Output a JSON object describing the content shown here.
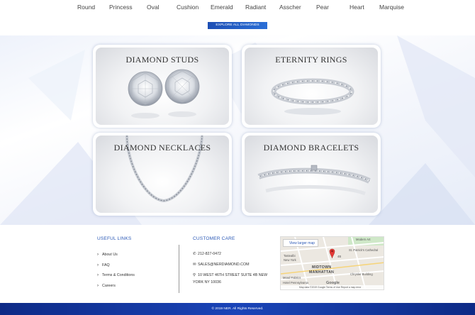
{
  "shapes": [
    "Round",
    "Princess",
    "Oval",
    "Cushion",
    "Emerald",
    "Radiant",
    "Asscher",
    "Pear",
    "Heart",
    "Marquise"
  ],
  "explore_label": "EXPLORE ALL DIAMONDS",
  "cards": [
    {
      "title": "DIAMOND STUDS"
    },
    {
      "title": "ETERNITY RINGS"
    },
    {
      "title": "DIAMOND NECKLACES"
    },
    {
      "title": "DIAMOND BRACELETS"
    }
  ],
  "footer": {
    "useful_links_heading": "USEFUL LINKS",
    "useful_links": [
      "About Us",
      "FAQ",
      "Terms & Conditions",
      "Careers"
    ],
    "customer_care_heading": "CUSTOMER CARE",
    "phone": "212-827-0472",
    "email": "SALES@NERDIAMOND.COM",
    "address_line1": "10 WEST 46TH STREET SUITE 4B NEW",
    "address_line2": "YORK NY 10036"
  },
  "map": {
    "view_larger": "View larger map",
    "labels": {
      "moma": "Modern Art",
      "tastealbi": "Tastealbi",
      "ny": "New York",
      "stpatrick": "St. Patrick's Cathedral",
      "midtown": "MIDTOWN",
      "manhattan": "MANHATTAN",
      "mood": "Mood Fabrics",
      "chrysler": "Chrysler Building",
      "pennsylvania": "Hotel Pennsylvania",
      "pin": "4B"
    },
    "google": "Google",
    "footer_text": "Map data ©2019 Google   Terms of Use   Report a map error"
  },
  "copyright": "© 2019 NER. All Rights Reserved.",
  "colors": {
    "accent": "#2a58b6",
    "footer_bar": "#1a44b8",
    "button": "#1e4fb5"
  }
}
